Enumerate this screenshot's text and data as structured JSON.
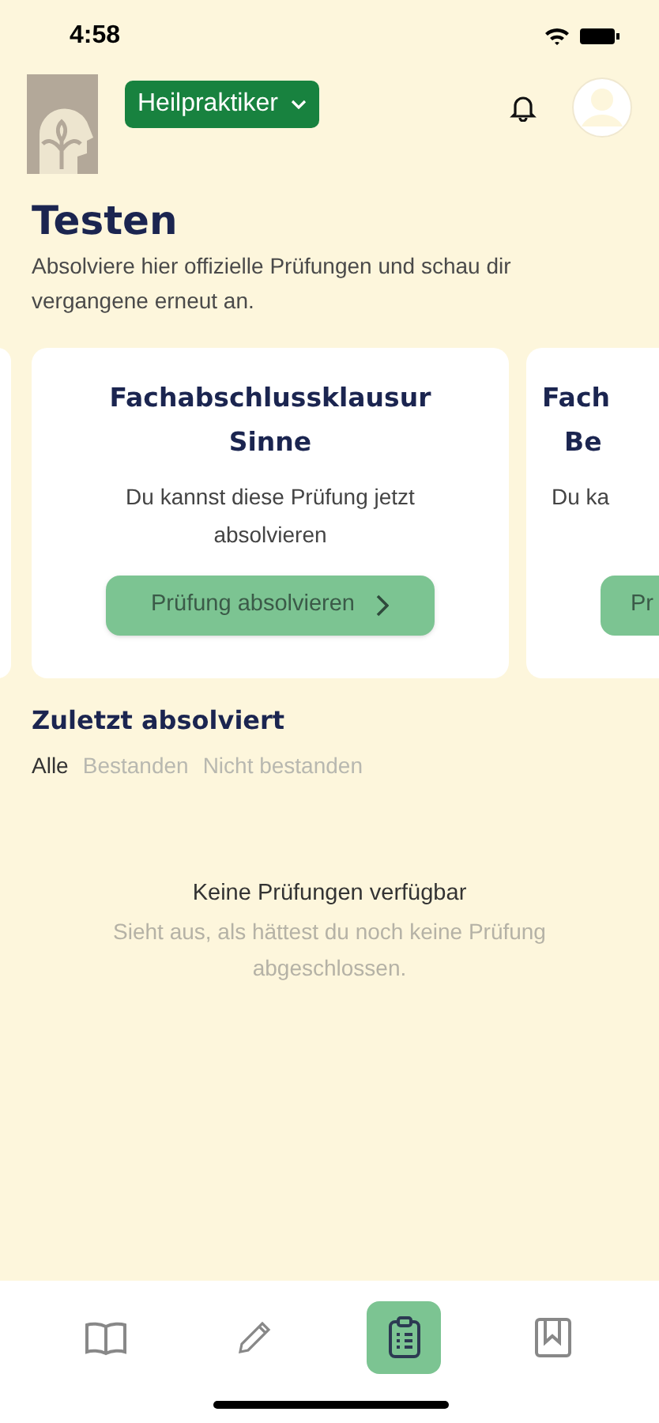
{
  "status_bar": {
    "time": "4:58"
  },
  "header": {
    "course": "Heilpraktiker"
  },
  "page": {
    "title": "Testen",
    "subtitle": "Absolviere hier offizielle Prüfungen und schau dir vergangene erneut an."
  },
  "exams": [
    {
      "title": "Fachabschlussklausur Sinne",
      "text": "Du kannst diese Prüfung jetzt absolvieren",
      "button": "Prüfung absolvieren"
    },
    {
      "title_lines": [
        "Fach",
        "Be"
      ],
      "text": "Du ka",
      "button": "Pr"
    }
  ],
  "recent": {
    "title": "Zuletzt absolviert",
    "filters": [
      {
        "label": "Alle",
        "selected": true
      },
      {
        "label": "Bestanden",
        "selected": false
      },
      {
        "label": "Nicht bestanden",
        "selected": false
      }
    ],
    "empty_title": "Keine Prüfungen verfügbar",
    "empty_text": "Sieht aus, als hättest du noch keine Prüfung abgeschlossen."
  },
  "nav": [
    {
      "kind": "book",
      "selected": false
    },
    {
      "kind": "pencil",
      "selected": false
    },
    {
      "kind": "clipboard",
      "selected": true
    },
    {
      "kind": "bookmark",
      "selected": false
    }
  ]
}
